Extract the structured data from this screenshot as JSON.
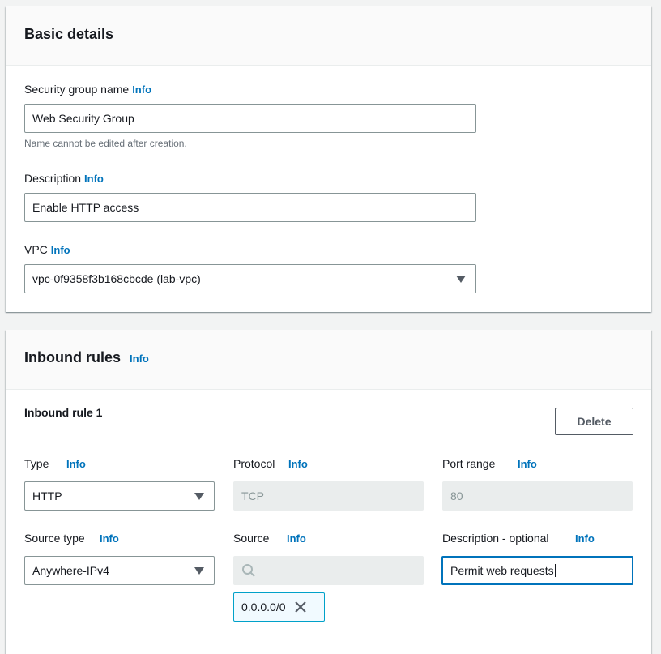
{
  "basic_details": {
    "title": "Basic details",
    "security_group_name": {
      "label": "Security group name",
      "info": "Info",
      "value": "Web Security Group",
      "hint": "Name cannot be edited after creation."
    },
    "description": {
      "label": "Description",
      "info": "Info",
      "value": "Enable HTTP access"
    },
    "vpc": {
      "label": "VPC",
      "info": "Info",
      "value": "vpc-0f9358f3b168cbcde (lab-vpc)"
    }
  },
  "inbound_rules": {
    "title": "Inbound rules",
    "info": "Info",
    "rule": {
      "title": "Inbound rule 1",
      "delete_label": "Delete",
      "type": {
        "label": "Type",
        "info": "Info",
        "value": "HTTP"
      },
      "protocol": {
        "label": "Protocol",
        "info": "Info",
        "value": "TCP"
      },
      "port_range": {
        "label": "Port range",
        "info": "Info",
        "value": "80"
      },
      "source_type": {
        "label": "Source type",
        "info": "Info",
        "value": "Anywhere-IPv4"
      },
      "source": {
        "label": "Source",
        "info": "Info",
        "search_value": "",
        "token": "0.0.0.0/0"
      },
      "description": {
        "label": "Description - optional",
        "info": "Info",
        "value": "Permit web requests"
      }
    }
  },
  "icons": {
    "select_caret": "caret-down-icon",
    "search": "search-icon",
    "remove": "close-icon"
  },
  "colors": {
    "link": "#0073bb",
    "focus_border": "#0073bb",
    "token_border": "#00a1c9",
    "token_background": "#f1faff",
    "disabled_background": "#eaeded"
  }
}
